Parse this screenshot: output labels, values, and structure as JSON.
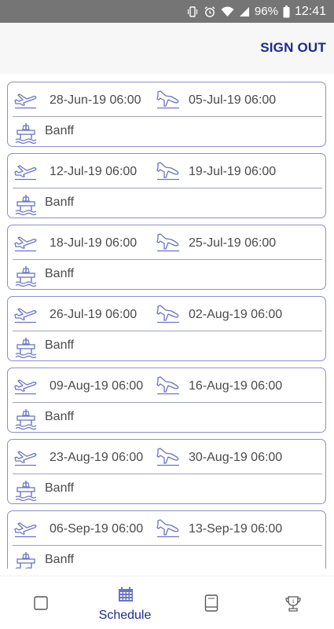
{
  "status_bar": {
    "battery_percent": "96%",
    "time": "12:41"
  },
  "header": {
    "sign_out_label": "SIGN OUT"
  },
  "trips": [
    {
      "depart": "28-Jun-19 06:00",
      "return": "05-Jul-19 06:00",
      "location": "Banff"
    },
    {
      "depart": "12-Jul-19 06:00",
      "return": "19-Jul-19 06:00",
      "location": "Banff"
    },
    {
      "depart": "18-Jul-19 06:00",
      "return": "25-Jul-19 06:00",
      "location": "Banff"
    },
    {
      "depart": "26-Jul-19 06:00",
      "return": "02-Aug-19 06:00",
      "location": "Banff"
    },
    {
      "depart": "09-Aug-19 06:00",
      "return": "16-Aug-19 06:00",
      "location": "Banff"
    },
    {
      "depart": "23-Aug-19 06:00",
      "return": "30-Aug-19 06:00",
      "location": "Banff"
    },
    {
      "depart": "06-Sep-19 06:00",
      "return": "13-Sep-19 06:00",
      "location": "Banff"
    }
  ],
  "bottom_nav": {
    "items": [
      {
        "icon": "checkbox-icon",
        "label": ""
      },
      {
        "icon": "calendar-icon",
        "label": "Schedule"
      },
      {
        "icon": "book-icon",
        "label": ""
      },
      {
        "icon": "trophy-icon",
        "label": ""
      }
    ]
  },
  "colors": {
    "accent": "#1e2a8c",
    "card_border": "#8c90c8",
    "icon": "#6a74c4",
    "status_bar": "#757575"
  }
}
